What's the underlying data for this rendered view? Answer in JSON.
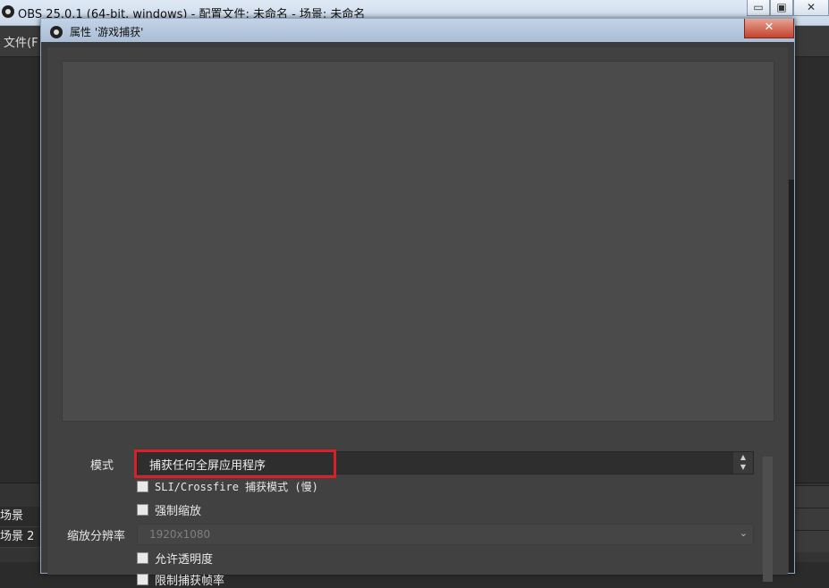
{
  "main_window": {
    "title": "OBS 25.0.1 (64-bit, windows) - 配置文件: 未命名 - 场景: 未命名",
    "menu_file": "文件(F",
    "window_buttons": {
      "minimize": "▭",
      "maximize": "▣",
      "close": "✕"
    },
    "scenes": [
      "场景",
      "场景 2"
    ]
  },
  "dialog": {
    "title": "属性 '游戏捕获'",
    "close_label": "✕",
    "properties": {
      "mode": {
        "label": "模式",
        "value": "捕获任何全屏应用程序",
        "spinner_icon": "updown-spinner-icon"
      },
      "sli_crossfire": {
        "label": "SLI/Crossfire 捕获模式 (慢)",
        "checked": false
      },
      "force_scaling": {
        "label": "强制缩放",
        "checked": false
      },
      "scale_resolution": {
        "label": "缩放分辨率",
        "value": "1920x1080",
        "disabled": true
      },
      "allow_transparency": {
        "label": "允许透明度",
        "checked": false
      },
      "limit_framerate": {
        "label": "限制捕获帧率",
        "checked": false
      }
    }
  },
  "colors": {
    "highlight": "#d7202a",
    "dialog_bg": "#414141",
    "preview_bg": "#4b4b4b"
  }
}
